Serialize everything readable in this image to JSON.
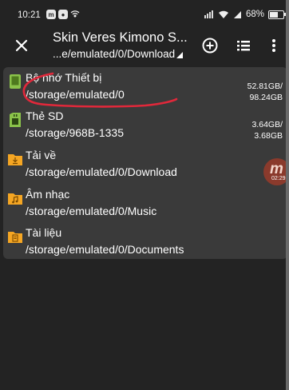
{
  "status_bar": {
    "time": "10:21",
    "battery": "68%",
    "battery_level": 0.68,
    "float_badge_time": "02:29"
  },
  "toolbar": {
    "title": "Skin Veres Kimono S...",
    "subtitle": "...e/emulated/0/Download"
  },
  "storage_list": [
    {
      "name": "Bộ nhớ Thiết bị",
      "path": "/storage/emulated/0",
      "size_used": "52.81GB/",
      "size_total": "98.24GB",
      "icon": "phone-storage-icon",
      "color": "#8bc34a"
    },
    {
      "name": "Thẻ SD",
      "path": "/storage/968B-1335",
      "size_used": "3.64GB/",
      "size_total": "3.68GB",
      "icon": "sd-card-icon",
      "color": "#8bc34a"
    }
  ],
  "folders": [
    {
      "name": "Tải về",
      "path": "/storage/emulated/0/Download",
      "icon": "download-folder-icon"
    },
    {
      "name": "Âm nhạc",
      "path": "/storage/emulated/0/Music",
      "icon": "music-folder-icon"
    },
    {
      "name": "Tài liệu",
      "path": "/storage/emulated/0/Documents",
      "icon": "documents-folder-icon"
    }
  ],
  "colors": {
    "background": "#232323",
    "panel": "#3a3a3a",
    "folder": "#f5a623",
    "storage_green": "#8bc34a",
    "annotation": "#e0283a"
  }
}
